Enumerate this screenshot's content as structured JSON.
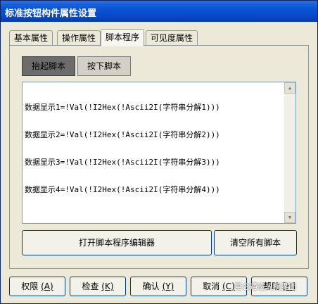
{
  "window": {
    "title": "标准按钮构件属性设置"
  },
  "tabs": [
    "基本属性",
    "操作属性",
    "脚本程序",
    "可见度属性"
  ],
  "subtabs": [
    "抬起脚本",
    "按下脚本"
  ],
  "script_lines": [
    "数据显示1=!Val(!I2Hex(!Ascii2I(字符串分解1)))",
    "数据显示2=!Val(!I2Hex(!Ascii2I(字符串分解2)))",
    "数据显示3=!Val(!I2Hex(!Ascii2I(字符串分解3)))",
    "数据显示4=!Val(!I2Hex(!Ascii2I(字符串分解4)))"
  ],
  "actions": {
    "open_editor": "打开脚本程序编辑器",
    "clear_all": "清空所有脚本"
  },
  "footer": {
    "permissions": {
      "label": "权限",
      "key": "(A)"
    },
    "check": {
      "label": "检查",
      "key": "(K)"
    },
    "confirm": {
      "label": "确认",
      "key": "(Y)"
    },
    "cancel": {
      "label": "取消",
      "key": "(C)"
    },
    "help": {
      "label": "帮助",
      "key": "[H]"
    }
  },
  "watermark": "昆仑通态人机界面"
}
